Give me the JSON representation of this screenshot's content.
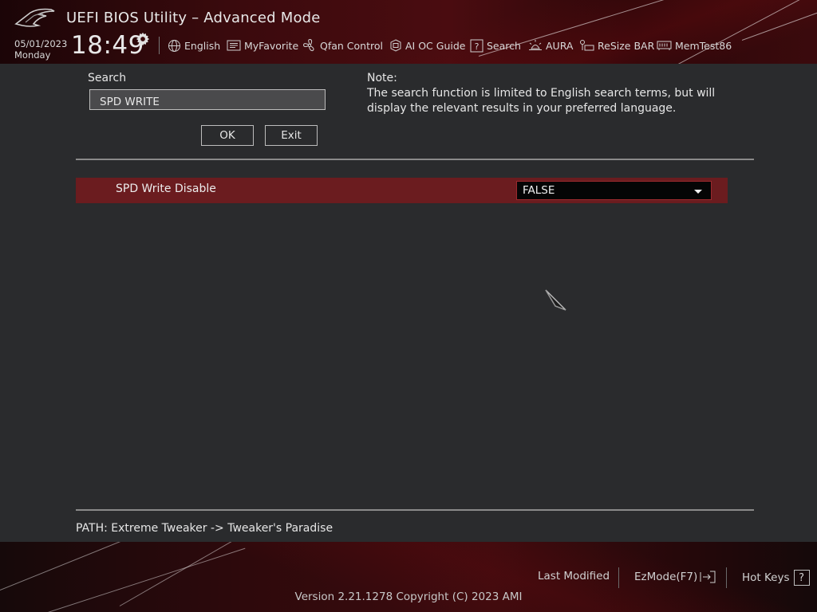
{
  "header": {
    "title": "UEFI BIOS Utility – Advanced Mode",
    "date": "05/01/2023",
    "day": "Monday",
    "time": "18:49",
    "nav": [
      {
        "label": "English",
        "icon": "globe-icon"
      },
      {
        "label": "MyFavorite",
        "icon": "favorite-list-icon"
      },
      {
        "label": "Qfan Control",
        "icon": "fan-icon"
      },
      {
        "label": "AI OC Guide",
        "icon": "ai-chip-icon"
      },
      {
        "label": "Search",
        "icon": "help-search-icon"
      },
      {
        "label": "AURA",
        "icon": "aura-light-icon"
      },
      {
        "label": "ReSize BAR",
        "icon": "resize-bar-icon"
      },
      {
        "label": "MemTest86",
        "icon": "memory-icon"
      }
    ]
  },
  "search": {
    "label": "Search",
    "value": "SPD WRITE",
    "ok_label": "OK",
    "exit_label": "Exit"
  },
  "note": {
    "title": "Note:",
    "text": "The search function is limited to English search terms, but will display the relevant results in your preferred language."
  },
  "results": [
    {
      "label": "SPD Write Disable",
      "value": "FALSE"
    }
  ],
  "path": "PATH: Extreme Tweaker -> Tweaker's Paradise",
  "footer": {
    "last_modified": "Last Modified",
    "ezmode": "EzMode(F7)",
    "hot_keys": "Hot Keys",
    "hot_keys_box": "?",
    "version": "Version 2.21.1278 Copyright (C) 2023 AMI"
  },
  "colors": {
    "accent": "#6b1c1f",
    "background": "#2a2b2d",
    "select_border": "#9a2a2e"
  }
}
